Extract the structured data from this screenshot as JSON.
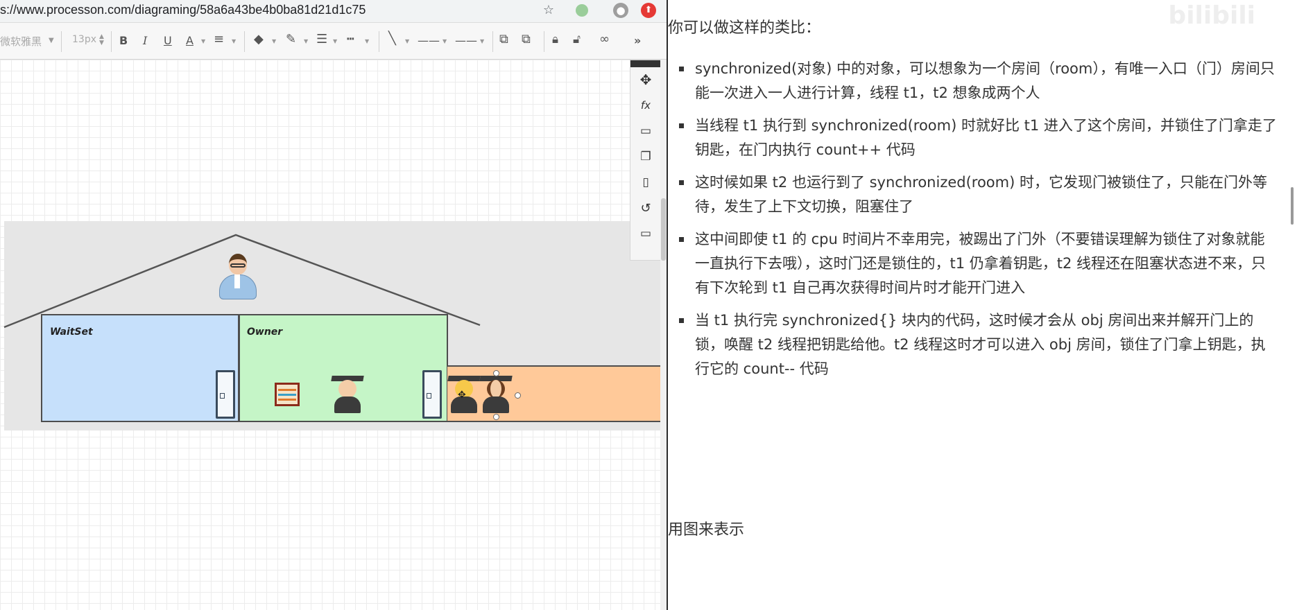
{
  "browser": {
    "url": "s://www.processon.com/diagraming/58a6a43be4b0ba81d21d1c75"
  },
  "toolbar": {
    "font_family": "微软雅黑",
    "font_size": "13px",
    "bold": "B",
    "italic": "I",
    "underline": "U",
    "font_color": "A"
  },
  "diagram": {
    "waitset_label": "WaitSet",
    "owner_label": "Owner"
  },
  "article": {
    "intro": "你可以做这样的类比：",
    "bullets": [
      "synchronized(对象) 中的对象，可以想象为一个房间（room），有唯一入口（门）房间只能一次进入一人进行计算，线程 t1，t2 想象成两个人",
      "当线程 t1 执行到 synchronized(room) 时就好比 t1 进入了这个房间，并锁住了门拿走了钥匙，在门内执行 count++ 代码",
      "这时候如果 t2 也运行到了 synchronized(room) 时，它发现门被锁住了，只能在门外等待，发生了上下文切换，阻塞住了",
      "这中间即使 t1 的 cpu 时间片不幸用完，被踢出了门外（不要错误理解为锁住了对象就能一直执行下去哦），这时门还是锁住的，t1 仍拿着钥匙，t2 线程还在阻塞状态进不来，只有下次轮到 t1 自己再次获得时间片时才能开门进入",
      "当 t1 执行完 synchronized{} 块内的代码，这时候才会从 obj 房间出来并解开门上的锁，唤醒 t2 线程把钥匙给他。t2 线程这时才可以进入 obj 房间，锁住了门拿上钥匙，执行它的 count-- 代码"
    ],
    "outro": "用图来表示"
  },
  "watermark": "bilibili"
}
